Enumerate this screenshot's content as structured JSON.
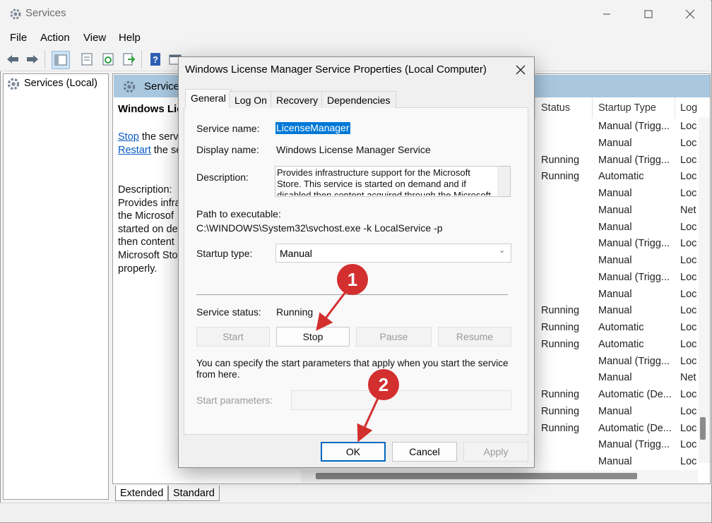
{
  "window": {
    "title": "Services"
  },
  "menu": [
    "File",
    "Action",
    "View",
    "Help"
  ],
  "tree": {
    "root": "Services (Local)"
  },
  "right_pane": {
    "header": "Services",
    "selected_title": "Windows Lic",
    "stop_link": "Stop",
    "stop_suffix": " the serv",
    "restart_link": "Restart",
    "restart_suffix": " the se",
    "description_label": "Description:",
    "description_lines": [
      "Provides infra",
      "the Microsof",
      "started on de",
      "then content",
      "Microsoft Sto",
      "properly."
    ],
    "columns": {
      "status": "Status",
      "startup": "Startup Type",
      "logon": "Log"
    },
    "rows": [
      {
        "status": "",
        "startup": "Manual (Trigg...",
        "logon": "Loc"
      },
      {
        "status": "",
        "startup": "Manual",
        "logon": "Loc"
      },
      {
        "status": "Running",
        "startup": "Manual (Trigg...",
        "logon": "Loc"
      },
      {
        "status": "Running",
        "startup": "Automatic",
        "logon": "Loc"
      },
      {
        "status": "",
        "startup": "Manual",
        "logon": "Loc"
      },
      {
        "status": "",
        "startup": "Manual",
        "logon": "Net"
      },
      {
        "status": "",
        "startup": "Manual",
        "logon": "Loc"
      },
      {
        "status": "",
        "startup": "Manual (Trigg...",
        "logon": "Loc"
      },
      {
        "status": "",
        "startup": "Manual",
        "logon": "Loc"
      },
      {
        "status": "",
        "startup": "Manual (Trigg...",
        "logon": "Loc"
      },
      {
        "status": "",
        "startup": "Manual",
        "logon": "Loc"
      },
      {
        "status": "Running",
        "startup": "Manual",
        "logon": "Loc"
      },
      {
        "status": "Running",
        "startup": "Automatic",
        "logon": "Loc"
      },
      {
        "status": "Running",
        "startup": "Automatic",
        "logon": "Loc"
      },
      {
        "status": "",
        "startup": "Manual (Trigg...",
        "logon": "Loc"
      },
      {
        "status": "",
        "startup": "Manual",
        "logon": "Net"
      },
      {
        "status": "Running",
        "startup": "Automatic (De...",
        "logon": "Loc"
      },
      {
        "status": "Running",
        "startup": "Manual",
        "logon": "Loc"
      },
      {
        "status": "Running",
        "startup": "Automatic (De...",
        "logon": "Loc"
      },
      {
        "status": "",
        "startup": "Manual (Trigg...",
        "logon": "Loc"
      },
      {
        "status": "",
        "startup": "Manual",
        "logon": "Loc"
      }
    ],
    "bottom_tabs": [
      "Extended",
      "Standard"
    ]
  },
  "dialog": {
    "title": "Windows License Manager Service Properties (Local Computer)",
    "tabs": [
      "General",
      "Log On",
      "Recovery",
      "Dependencies"
    ],
    "service_name_label": "Service name:",
    "service_name": "LicenseManager",
    "display_name_label": "Display name:",
    "display_name": "Windows License Manager Service",
    "description_label": "Description:",
    "description": "Provides infrastructure support for the Microsoft Store.  This service is started on demand and if disabled then content acquired through the Microsoft",
    "path_label": "Path to executable:",
    "path": "C:\\WINDOWS\\System32\\svchost.exe -k LocalService -p",
    "startup_label": "Startup type:",
    "startup_value": "Manual",
    "status_label": "Service status:",
    "status_value": "Running",
    "buttons": {
      "start": "Start",
      "stop": "Stop",
      "pause": "Pause",
      "resume": "Resume"
    },
    "hint": [
      "You can specify the start parameters that apply when you start the service",
      "from here."
    ],
    "params_label": "Start parameters:",
    "ok": "OK",
    "cancel": "Cancel",
    "apply": "Apply"
  },
  "annotations": {
    "step1": "1",
    "step2": "2",
    "color": "#d32f2f"
  }
}
